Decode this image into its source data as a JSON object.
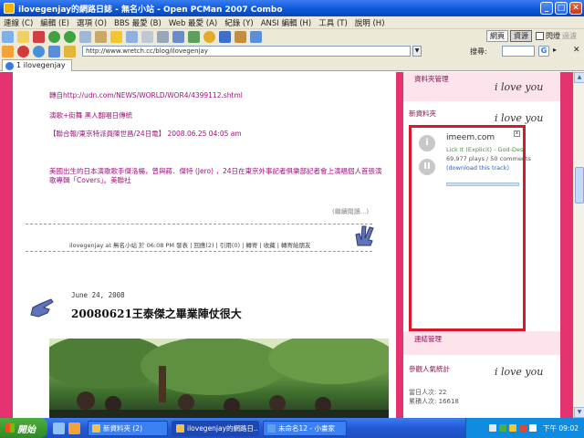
{
  "window": {
    "title": "ilovegenjay的網路日誌 - 無名小站 - Open PCMan 2007 Combo"
  },
  "menu": [
    "連線 (C)",
    "編輯 (E)",
    "選項 (O)",
    "BBS 最愛 (B)",
    "Web 最愛 (A)",
    "紀錄 (Y)",
    "ANSI 編輯 (H)",
    "工具 (T)",
    "說明 (H)"
  ],
  "toolbar": {
    "modes": [
      "網頁",
      "資源",
      "閃燈"
    ],
    "mode_active": "資源",
    "right_extra": "過濾"
  },
  "address": {
    "url": "http://www.wretch.cc/blog/ilovegenjay",
    "search_label": "搜尋:",
    "search_value": ""
  },
  "tab": {
    "label": "1 ilovegenjay"
  },
  "post1": {
    "source_link": "轉自http://udn.com/NEWS/WORLD/WOR4/4399112.shtml",
    "subtitle": "演歌+街舞  黑人翻唱日傳統",
    "byline": "【聯合報/東京特派員陳世昌/24日電】  2008.06.25 04:05 am",
    "body": "美國出生的日本演歌歌手傑洛楊，曾與蔣．傑特 (Jero) ，24日在東京外事記者俱樂部記者會上演唱個人首張演歌專輯「Covers」。美聯社",
    "more": "(繼續閱讀...)",
    "meta": "ilovegenjay at 無名小站 於 06:08 PM 發表 | 回應(2) | 引用(0) | 轉寄 | 收藏 | 轉寄給朋友"
  },
  "post2": {
    "date": "June 24, 2008",
    "title": "20080621王泰傑之畢業陣仗很大"
  },
  "sidebar": {
    "header_manage": "資料夾管理",
    "header_new": "新資料夾",
    "ilove_text": "i love you",
    "widget": {
      "site": "imeem.com",
      "track": "Lick It (Explicit) - God-Des",
      "stats": "69,977 plays / 50 comments",
      "download": "(download this track)"
    },
    "link_manage": "連結管理",
    "counter_title": "參觀人氣統計",
    "today": "當日人次: 22",
    "total": "累積人次: 16618"
  },
  "taskbar": {
    "start": "開始",
    "buttons": [
      "新資料夾 (2)",
      "ilovegenjay的網路日...",
      "未命名12 - 小畫家"
    ],
    "active_index": 1,
    "clock": "下午 09:02"
  },
  "colors": {
    "brand_pink": "#e4316f",
    "post_text": "#a0127a",
    "widget_border": "#d8182b"
  }
}
